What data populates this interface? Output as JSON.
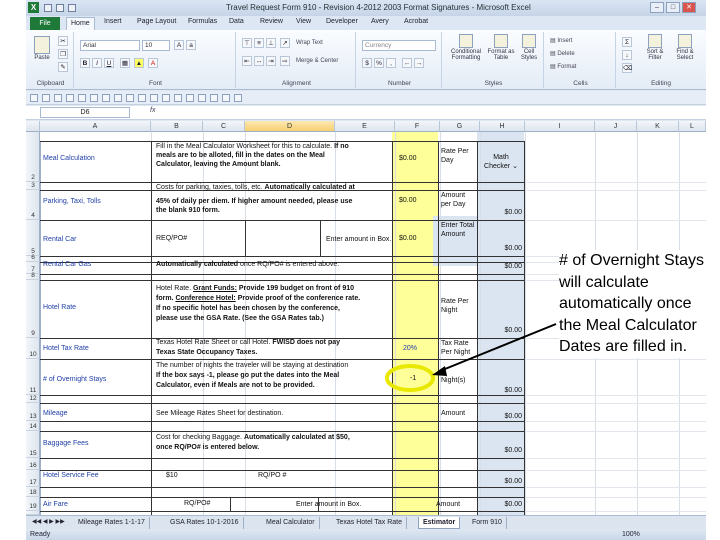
{
  "window": {
    "title": "Travel Request Form 910 - Revision 4-2012 2003 Format Signatures - Microsoft Excel",
    "app_icon": "X"
  },
  "tabs": [
    {
      "label": "File"
    },
    {
      "label": "Home"
    },
    {
      "label": "Insert"
    },
    {
      "label": "Page Layout"
    },
    {
      "label": "Formulas"
    },
    {
      "label": "Data"
    },
    {
      "label": "Review"
    },
    {
      "label": "View"
    },
    {
      "label": "Developer"
    },
    {
      "label": "Avery"
    },
    {
      "label": "Acrobat"
    }
  ],
  "ribbon": {
    "paste": "Paste",
    "font_name": "Arial",
    "font_size": "10",
    "wrap_text": "Wrap Text",
    "merge_center": "Merge & Center",
    "number_format": "Currency",
    "conditional_formatting": "Conditional Formatting",
    "format_as_table": "Format as Table",
    "cell_styles": "Cell Styles",
    "insert": "Insert",
    "delete": "Delete",
    "format": "Format",
    "sort_filter": "Sort & Filter",
    "find_select": "Find & Select",
    "groups": {
      "clipboard": "Clipboard",
      "font": "Font",
      "alignment": "Alignment",
      "number": "Number",
      "styles": "Styles",
      "cells": "Cells",
      "editing": "Editing"
    }
  },
  "formula_bar": {
    "name_box": "D6",
    "fx": "fx"
  },
  "columns": [
    "A",
    "B",
    "C",
    "D",
    "E",
    "F",
    "G",
    "H",
    "I",
    "J",
    "K",
    "L"
  ],
  "rows": [
    "2",
    "3",
    "4",
    "5",
    "6",
    "7",
    "8",
    "9",
    "10",
    "11",
    "12",
    "13",
    "14",
    "15",
    "16",
    "17",
    "18",
    "19",
    "20"
  ],
  "cells": {
    "meal_label": "Meal Calculation",
    "meal_desc_1a": "Fill in the Meal Calculator Worksheet for this to calculate. ",
    "meal_desc_1b": "If no",
    "meal_desc_2": "meals are to be alloted, fill in the dates on the Meal",
    "meal_desc_3": "Calculator, leaving the Amount blank.",
    "meal_amount": "$0.00",
    "rate_per_day": "Rate Per Day",
    "math_checker": "Math Checker",
    "parking_label": "Parking, Taxi, Tolls",
    "parking_desc_1a": "Costs for parking, taxies, tolls, etc. ",
    "parking_desc_1b": "Automatically calculated at",
    "parking_desc_2": "45% of daily per diem. If higher amount needed, please use",
    "parking_desc_3": "the blank 910 form.",
    "parking_amount": "$0.00",
    "amount_per_day": "Amount per Day",
    "h4_total": "$0.00",
    "rental_car_label": "Rental Car",
    "rental_car_po": "REQ/PO#",
    "enter_amount": "Enter amount in Box.",
    "rental_car_amount": "$0.00",
    "enter_total_amount": "Enter Total Amount",
    "h6_total": "$0.00",
    "rental_gas_label": "Rental Car Gas",
    "rental_gas_desc_a": "Automatically calculated ",
    "rental_gas_desc_b": "once RQ/PO# is entered above.",
    "h7_total": "$0.00",
    "hotel_rate_label": "Hotel Rate",
    "hotel_desc_1a": "Hotel Rate. ",
    "hotel_desc_1b": "Grant Funds:",
    "hotel_desc_1c": " Provide 199 budget on front of 910",
    "hotel_desc_2a": "form. ",
    "hotel_desc_2b": "Conference Hotel:",
    "hotel_desc_2c": " Provide proof of the conference rate.",
    "hotel_desc_3": "If no specific hotel has been chosen by the conference,",
    "hotel_desc_4": "please use the GSA Rate. (See the GSA Rates tab.)",
    "rate_per_night": "Rate Per Night",
    "h9_total": "$0.00",
    "hotel_tax_label": "Hotel Tax Rate",
    "hotel_tax_desc_1a": "Texas Hotel Rate Sheet or call Hotel. ",
    "hotel_tax_desc_1b": "FWISD does not pay",
    "hotel_tax_desc_2": "Texas State Occupancy Taxes.",
    "hotel_tax_rate": "20%",
    "tax_rate_per_night": "Tax Rate Per Night",
    "overnight_label": "# of Overnight Stays",
    "overnight_desc_1": "The number of nights the traveler will be staying at destination",
    "overnight_desc_2": "If the box says -1, please go put the dates into the Meal",
    "overnight_desc_3": "Calculator, even if Meals are not to be provided.",
    "overnight_value": "-1",
    "nights": "Night(s)",
    "h11_total": "$0.00",
    "mileage_label": "Mileage",
    "mileage_desc": "See Mileage Rates Sheet for destination.",
    "mileage_amount": "Amount",
    "h13_total": "$0.00",
    "baggage_label": "Baggage Fees",
    "baggage_desc_1a": "Cost for checking Baggage. ",
    "baggage_desc_1b": "Automatically calculated at $50,",
    "baggage_desc_2": "once RQ/PO# is entered below.",
    "h15_total": "$0.00",
    "hotel_service_label": "Hotel Service Fee",
    "hotel_service_value": "$10",
    "hotel_service_po": "RQ/PO #",
    "h17_total": "$0.00",
    "airfare_label": "Air Fare",
    "airfare_po": "RQ/PO#",
    "airfare_enter": "Enter amount in Box.",
    "airfare_amount": "Amount",
    "h19_total": "$0.00"
  },
  "sheet_tabs": [
    {
      "label": "Mileage Rates 1-1-17"
    },
    {
      "label": "GSA Rates 10-1-2016"
    },
    {
      "label": "Meal Calculator"
    },
    {
      "label": "Texas Hotel Tax Rate"
    },
    {
      "label": "Estimator"
    },
    {
      "label": "Form 910"
    }
  ],
  "status": {
    "ready": "Ready",
    "zoom": "100%"
  },
  "annotation": {
    "text": "# of Overnight Stays will calculate automatically once the Meal Calculator Dates are filled in."
  },
  "colors": {
    "file_tab": "#1f7a3a",
    "input_yellow": "#ffff99",
    "label_blue": "#1f3fa7",
    "total_blue": "#dbe5f1",
    "circle_highlight": "#e8e800"
  }
}
